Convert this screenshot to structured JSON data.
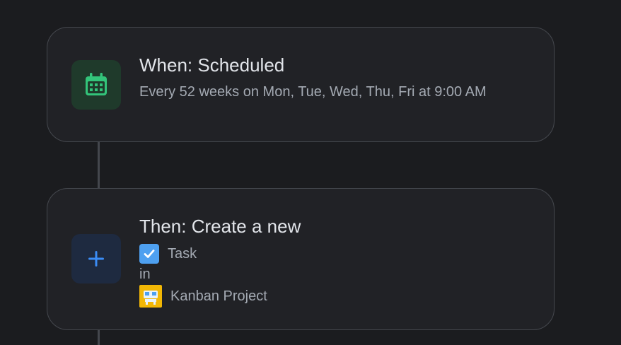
{
  "trigger": {
    "title": "When: Scheduled",
    "description": "Every 52 weeks on Mon, Tue, Wed, Thu, Fri at 9:00 AM",
    "icon": "calendar-icon",
    "accent": "#33c47a"
  },
  "action": {
    "title": "Then: Create a new",
    "object_type": "Task",
    "preposition": "in",
    "target": "Kanban Project",
    "icon": "plus-icon",
    "accent": "#3b8cf5"
  }
}
